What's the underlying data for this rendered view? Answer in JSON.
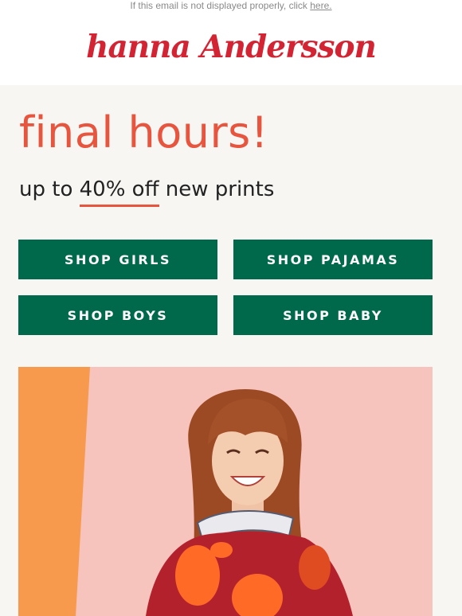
{
  "preheader": {
    "text": "If this email is not displayed properly, click ",
    "link_label": "here."
  },
  "brand": {
    "logo_text": "hanna Andersson",
    "color": "#d32434"
  },
  "hero": {
    "headline": "final hours!",
    "sub_prefix": "up to ",
    "sub_highlight": "40% off",
    "sub_suffix": " new prints",
    "accent_color": "#e8553f"
  },
  "buttons": {
    "girls": "SHOP GIRLS",
    "pajamas": "SHOP PAJAMAS",
    "boys": "SHOP BOYS",
    "baby": "SHOP BABY",
    "color": "#00694c"
  },
  "photo": {
    "alt": "Smiling girl in red print dress against pink background",
    "background_color": "#f6c3bd",
    "stripe_color": "#f79a4e"
  }
}
